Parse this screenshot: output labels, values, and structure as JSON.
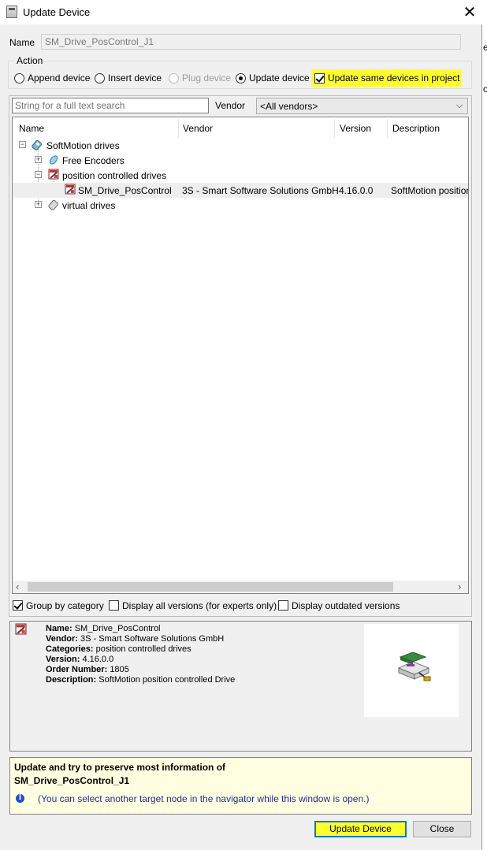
{
  "window": {
    "title": "Update Device",
    "close_glyph": "✕"
  },
  "name_row": {
    "label": "Name",
    "value": "SM_Drive_PosControl_J1"
  },
  "action": {
    "legend": "Action",
    "options": [
      {
        "label": "Append device",
        "selected": false,
        "enabled": true
      },
      {
        "label": "Insert device",
        "selected": false,
        "enabled": true
      },
      {
        "label": "Plug device",
        "selected": false,
        "enabled": false
      },
      {
        "label": "Update device",
        "selected": true,
        "enabled": true
      }
    ],
    "update_same_label": "Update same devices in project",
    "update_same_checked": true,
    "highlight_color": "#ffff2e"
  },
  "search": {
    "placeholder": "String for a full text search",
    "vendor_label": "Vendor",
    "vendor_value": "<All vendors>"
  },
  "tree": {
    "columns": [
      "Name",
      "Vendor",
      "Version",
      "Description"
    ],
    "rows": [
      {
        "name": "SoftMotion drives",
        "vendor": "",
        "version": "",
        "description": "",
        "icon": "drive-icon",
        "expander": "−"
      },
      {
        "name": "Free Encoders",
        "vendor": "",
        "version": "",
        "description": "",
        "icon": "encoder-icon",
        "expander": "+"
      },
      {
        "name": "position controlled drives",
        "vendor": "",
        "version": "",
        "description": "",
        "icon": "position-drive-icon",
        "expander": "−"
      },
      {
        "name": "SM_Drive_PosControl",
        "vendor": "3S - Smart Software Solutions GmbH",
        "version": "4.16.0.0",
        "description": "SoftMotion position c",
        "icon": "position-drive-icon",
        "expander": ""
      },
      {
        "name": "virtual drives",
        "vendor": "",
        "version": "",
        "description": "",
        "icon": "virtual-drive-icon",
        "expander": "+"
      }
    ]
  },
  "scroll": {
    "left": "‹",
    "right": "›"
  },
  "options": {
    "group_by_category": {
      "label": "Group by category",
      "checked": true
    },
    "display_all_versions": {
      "label": "Display all versions (for experts only)",
      "checked": false
    },
    "display_outdated": {
      "label": "Display outdated versions",
      "checked": false
    }
  },
  "details": {
    "name_key": "Name:",
    "name_val": "SM_Drive_PosControl",
    "vendor_key": "Vendor:",
    "vendor_val": "3S - Smart Software Solutions GmbH",
    "categories_key": "Categories:",
    "categories_val": "position controlled drives",
    "version_key": "Version:",
    "version_val": "4.16.0.0",
    "order_key": "Order Number:",
    "order_val": "1805",
    "description_key": "Description:",
    "description_val": "SoftMotion position controlled Drive"
  },
  "message": {
    "line1": "Update and try to preserve most information of",
    "line2": "SM_Drive_PosControl_J1",
    "info_glyph": "i",
    "note": "(You can select another target node in the navigator while this window is open.)"
  },
  "buttons": {
    "update": "Update Device",
    "close": "Close"
  },
  "background_fragments": [
    "e",
    "o"
  ]
}
